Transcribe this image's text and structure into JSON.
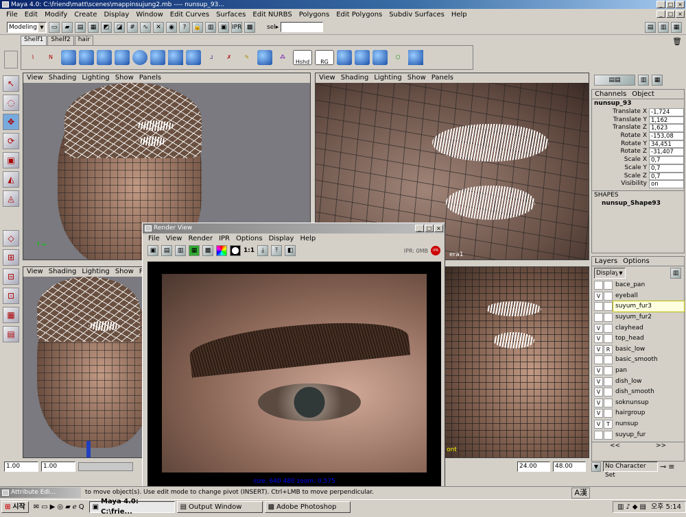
{
  "window": {
    "title": "Maya 4.0: C:\\friend\\matt\\scenes\\mappinsujung2.mb   ----   nunsup_93..."
  },
  "menu": [
    "File",
    "Edit",
    "Modify",
    "Create",
    "Display",
    "Window",
    "Edit Curves",
    "Surfaces",
    "Edit NURBS",
    "Polygons",
    "Edit Polygons",
    "Subdiv Surfaces",
    "Help"
  ],
  "toolbar": {
    "mode": "Modeling",
    "sel_label": "sel▸",
    "sel_value": ""
  },
  "shelf": {
    "tabs": [
      "Shelf1",
      "Shelf2",
      "hair"
    ],
    "labels": [
      "Hshd",
      "RG"
    ]
  },
  "viewport_menu": [
    "View",
    "Shading",
    "Lighting",
    "Show",
    "Panels"
  ],
  "viewports": {
    "persp_label": "",
    "camera_label": "era1",
    "front_label": "ont"
  },
  "channels": {
    "tabs": [
      "Channels",
      "Object"
    ],
    "object": "nunsup_93",
    "rows": [
      [
        "Translate X",
        "-1,724"
      ],
      [
        "Translate Y",
        "1,162"
      ],
      [
        "Translate Z",
        "1,623"
      ],
      [
        "Rotate X",
        "-153,08"
      ],
      [
        "Rotate Y",
        "34,451"
      ],
      [
        "Rotate Z",
        "-31,407"
      ],
      [
        "Scale X",
        "0,7"
      ],
      [
        "Scale Y",
        "0,7"
      ],
      [
        "Scale Z",
        "0,7"
      ],
      [
        "Visibility",
        "on"
      ]
    ],
    "shapes_title": "SHAPES",
    "shape": "nunsup_Shape93"
  },
  "layers": {
    "tabs": [
      "Layers",
      "Options"
    ],
    "display": "Display",
    "items": [
      {
        "v": "",
        "t": "",
        "name": "bace_pan"
      },
      {
        "v": "V",
        "t": "",
        "name": "eyeball"
      },
      {
        "v": "",
        "t": "",
        "name": "suyum_fur3"
      },
      {
        "v": "",
        "t": "",
        "name": "suyum_fur2"
      },
      {
        "v": "V",
        "t": "",
        "name": "clayhead"
      },
      {
        "v": "V",
        "t": "",
        "name": "top_head"
      },
      {
        "v": "V",
        "t": "R",
        "name": "basic_low"
      },
      {
        "v": "",
        "t": "",
        "name": "basic_smooth"
      },
      {
        "v": "V",
        "t": "",
        "name": "pan"
      },
      {
        "v": "V",
        "t": "",
        "name": "dish_low"
      },
      {
        "v": "V",
        "t": "",
        "name": "dish_smooth"
      },
      {
        "v": "V",
        "t": "",
        "name": "soknunsup"
      },
      {
        "v": "V",
        "t": "",
        "name": "hairgroup"
      },
      {
        "v": "V",
        "t": "T",
        "name": "nunsup"
      },
      {
        "v": "",
        "t": "",
        "name": "suyup_fur"
      }
    ],
    "scroll_left": "<<",
    "scroll_right": ">>"
  },
  "render_view": {
    "title": "Render View",
    "menu": [
      "File",
      "View",
      "Render",
      "IPR",
      "Options",
      "Display",
      "Help"
    ],
    "scale": "1:1",
    "ipr": "IPR: 0MB",
    "ipr_badge": "IPR",
    "info": "size: 640  480 zoom: 0.575"
  },
  "time": {
    "start": "1.00",
    "current": "1.00",
    "end": "24.00",
    "range_end": "48.00",
    "charset": "No Character Set"
  },
  "help": {
    "panel": "Attribute Edi...",
    "text": "to move object(s). Use edit mode to change pivot (INSERT). Ctrl+LMB to move perpendicular."
  },
  "ime": "A漢",
  "taskbar": {
    "start": "시작",
    "tasks": [
      "Maya 4.0: C:\\frie...",
      "Output Window",
      "Adobe Photoshop"
    ],
    "clock": "오후 5:14"
  }
}
